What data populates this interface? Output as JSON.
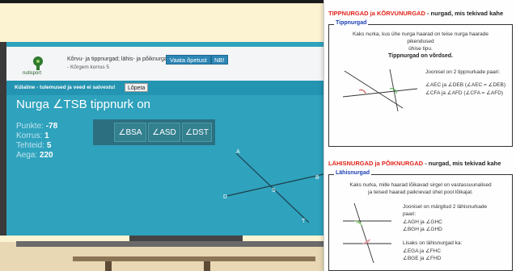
{
  "lesson": {
    "logo_text": "nutisport",
    "title_line1": "Kõrvu- ja tippnurgad; lähis- ja põiknurgad",
    "title_line2": "- Kõrgem korrus 5",
    "view_lesson_label": "Vaata õpetust",
    "nb_label": "NB!"
  },
  "session": {
    "guest_notice": "Külaline - tulemused ja veed ei salvestu!",
    "finish_label": "Lõpeta"
  },
  "question": {
    "text": "Nurga ∠TSB tippnurk on",
    "answers": [
      "∠BSA",
      "∠ASD",
      "∠DST"
    ]
  },
  "stats": {
    "points_label": "Punkte:",
    "points": "-78",
    "floor_label": "Korrus:",
    "floor": "1",
    "done_label": "Tehteid:",
    "done": "5",
    "time_label": "Aega:",
    "time": "220"
  },
  "figure": {
    "labels": [
      "A",
      "D",
      "B",
      "T",
      "S"
    ]
  },
  "panel": {
    "section1": {
      "heading": "TIPPNURGAD ja KÕRVUNURGAD",
      "heading_suffix": "- nurgad, mis tekivad kahe",
      "legend": "Tippnurgad",
      "text_line1": "Kaks nurka, kus ühe nurga haarad on teise nurga haarade",
      "text_line2": "pikendused",
      "text_line3": "ühise tipu.",
      "bold": "Tippnurgad on võrdsed.",
      "fig_caption1": "Joonisel on 2 tippnurkade paari:",
      "fig_caption2": "∠AEC ja ∠DEB (∠AEC = ∠DEB)",
      "fig_caption3": "∠CFA ja ∠AFD (∠CFA = ∠AFD)"
    },
    "section2": {
      "heading": "LÄHISNURGAD ja PÕIKNURGAD",
      "heading_suffix": "- nurgad, mis tekivad kahe",
      "legend": "Lähisnurgad",
      "text_line1": "Kaks nurka, mille haarad lõikavad sirgel on vastassuunalised",
      "text_line2": "ja teised haarad paiknevad ühel pool lõikajat.",
      "cap1": "Joonisel on märgitud 2 lähisnurkade",
      "cap2": "paari:",
      "cap3": "∠AGH ja ∠GHC",
      "cap4": "∠BGH ja ∠GHD",
      "cap5": "Lisaks on lähisnurgad ka:",
      "cap6": "∠EGA ja ∠FHC",
      "cap7": "∠BGE ja ∠FHD"
    }
  },
  "colors": {
    "screen": "#2fa2bd",
    "heading_red": "#e2231a",
    "legend_blue": "#1a3fb0"
  }
}
